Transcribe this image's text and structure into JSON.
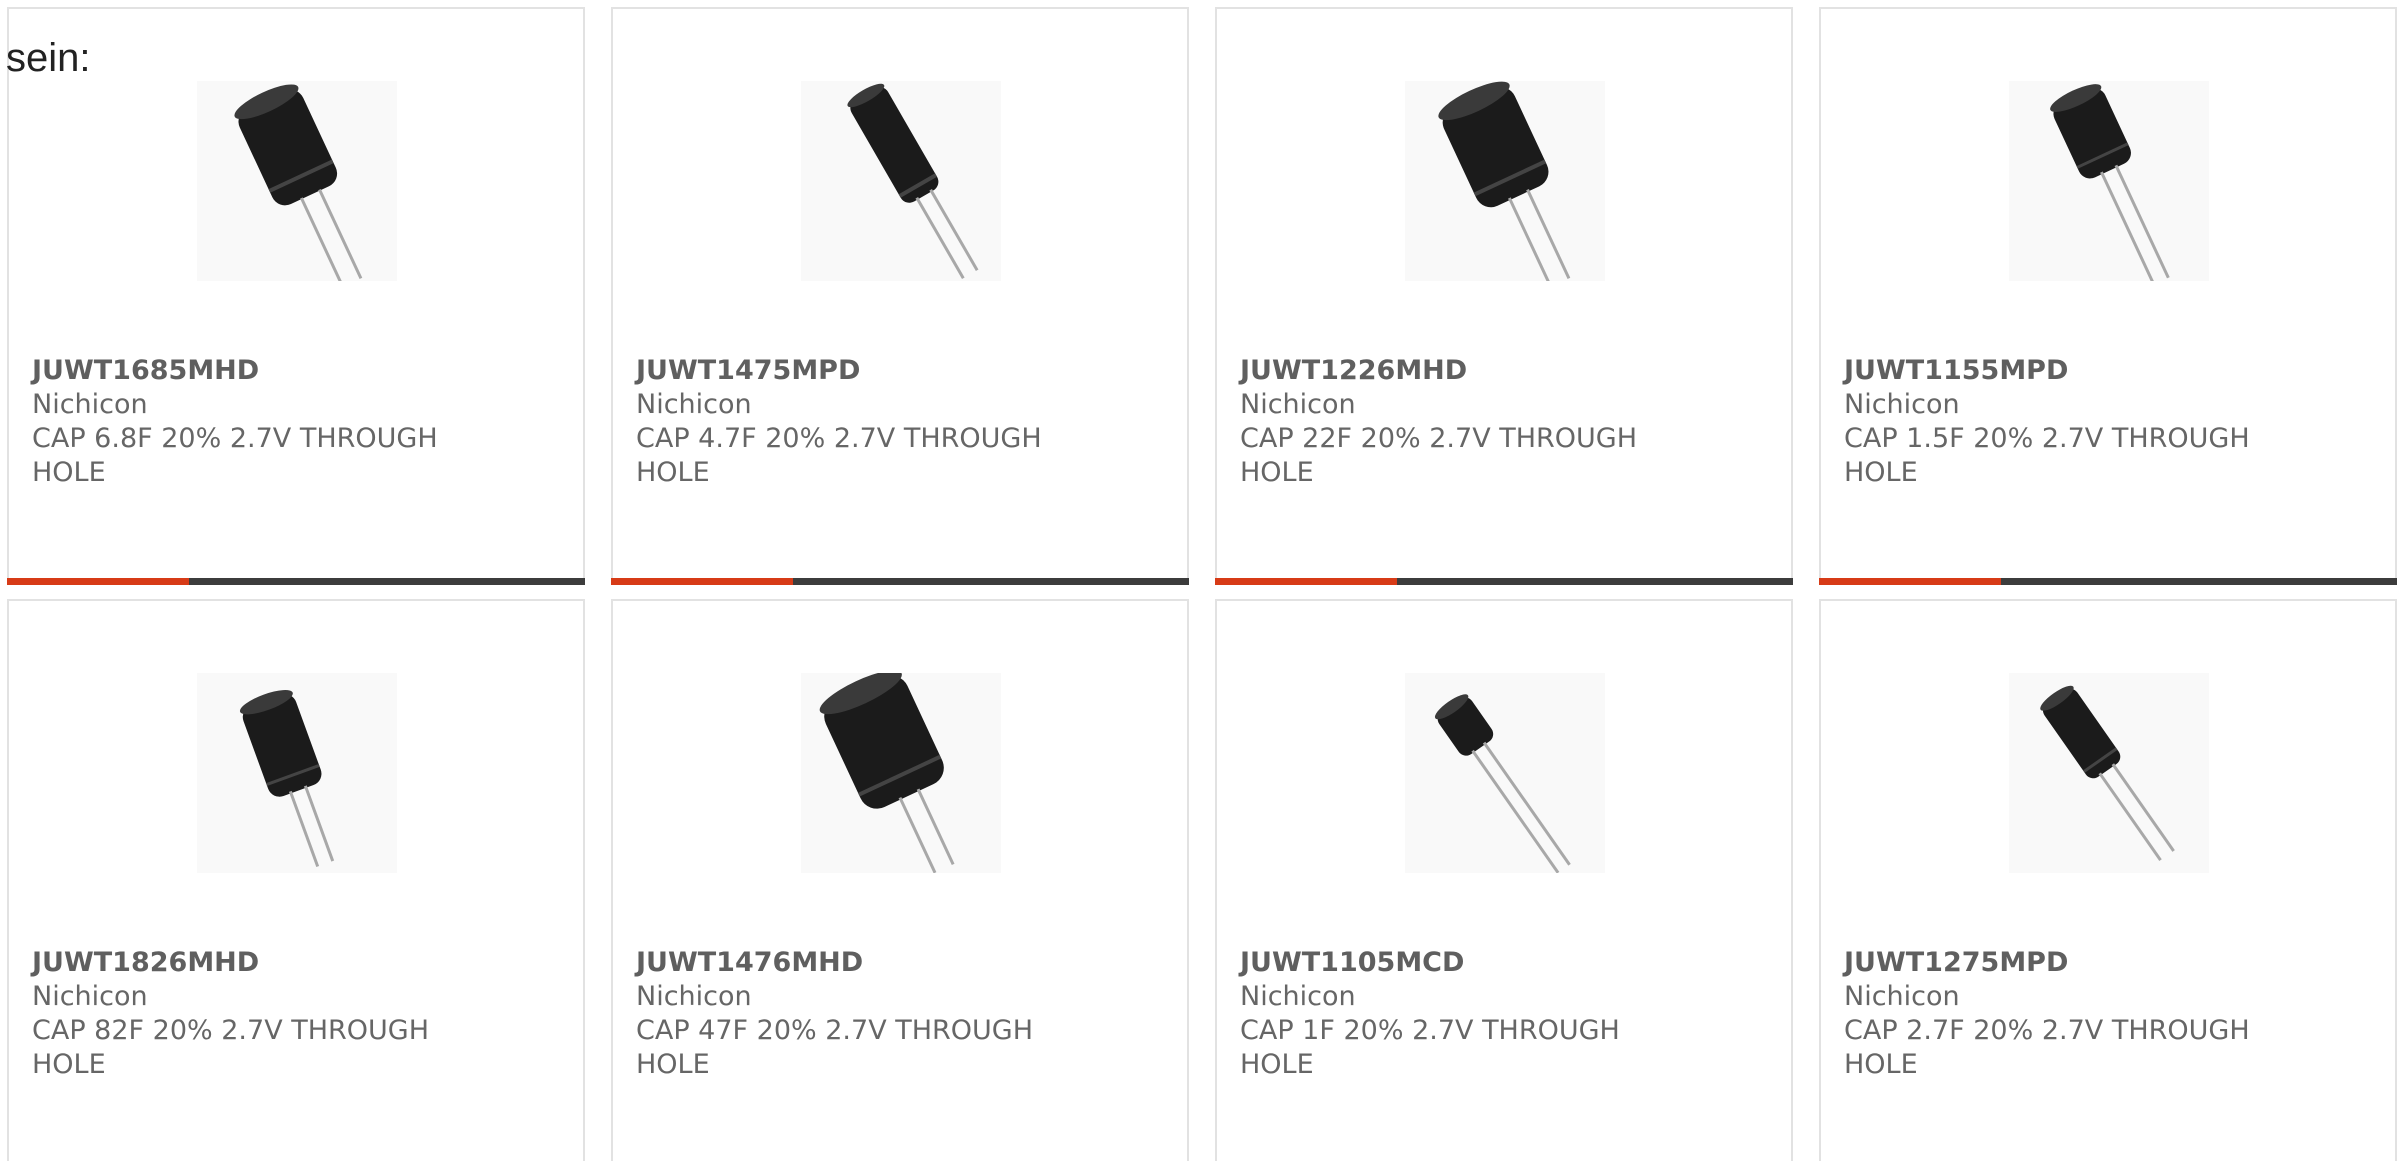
{
  "intro_text": "sein:",
  "products": [
    {
      "part": "JUWT1685MHD",
      "manufacturer": "Nichicon",
      "desc_line1": "CAP 6.8F 20% 2.7V THROUGH",
      "desc_line2": "HOLE",
      "image_icon": "capacitor-image"
    },
    {
      "part": "JUWT1475MPD",
      "manufacturer": "Nichicon",
      "desc_line1": "CAP 4.7F 20% 2.7V THROUGH",
      "desc_line2": "HOLE",
      "image_icon": "capacitor-image"
    },
    {
      "part": "JUWT1226MHD",
      "manufacturer": "Nichicon",
      "desc_line1": "CAP 22F 20% 2.7V THROUGH",
      "desc_line2": "HOLE",
      "image_icon": "capacitor-image"
    },
    {
      "part": "JUWT1155MPD",
      "manufacturer": "Nichicon",
      "desc_line1": "CAP 1.5F 20% 2.7V THROUGH",
      "desc_line2": "HOLE",
      "image_icon": "capacitor-image"
    },
    {
      "part": "JUWT1826MHD",
      "manufacturer": "Nichicon",
      "desc_line1": "CAP 82F 20% 2.7V THROUGH",
      "desc_line2": "HOLE",
      "image_icon": "capacitor-image"
    },
    {
      "part": "JUWT1476MHD",
      "manufacturer": "Nichicon",
      "desc_line1": "CAP 47F 20% 2.7V THROUGH",
      "desc_line2": "HOLE",
      "image_icon": "capacitor-image"
    },
    {
      "part": "JUWT1105MCD",
      "manufacturer": "Nichicon",
      "desc_line1": "CAP 1F 20% 2.7V THROUGH",
      "desc_line2": "HOLE",
      "image_icon": "capacitor-image"
    },
    {
      "part": "JUWT1275MPD",
      "manufacturer": "Nichicon",
      "desc_line1": "CAP 2.7F 20% 2.7V THROUGH",
      "desc_line2": "HOLE",
      "image_icon": "capacitor-image"
    }
  ],
  "colors": {
    "accent": "#d73b17",
    "bar_dark": "#3c3c3c",
    "text": "#666666",
    "border": "#e2e2e2"
  }
}
